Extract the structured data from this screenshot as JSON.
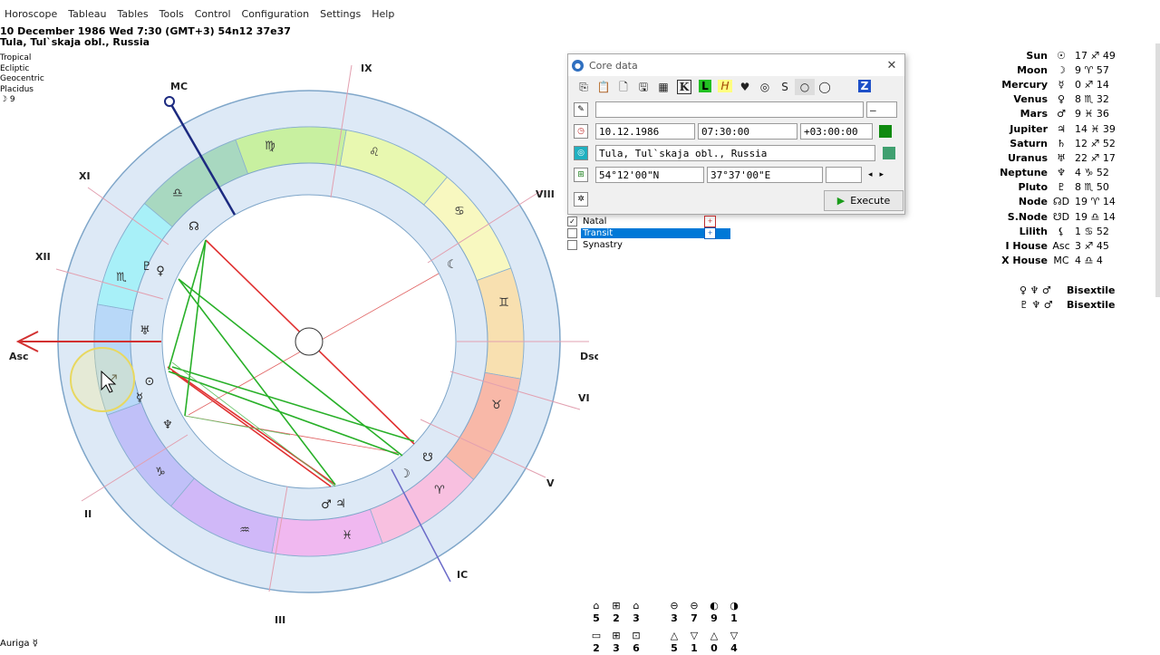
{
  "menu": [
    "Horoscope",
    "Tableau",
    "Tables",
    "Tools",
    "Control",
    "Configuration",
    "Settings",
    "Help"
  ],
  "header": {
    "line1": "10 December 1986  Wed   7:30 (GMT+3) 54n12  37e37",
    "line2": "Tula, Tul`skaja obl., Russia"
  },
  "modes": [
    "Tropical",
    "Ecliptic",
    "Geocentric",
    "Placidus",
    "☽   9"
  ],
  "bottom_label": "Auriga   ☿",
  "chart": {
    "roman": [
      "IX",
      "XI",
      "XII",
      "II",
      "III",
      "IC",
      "V",
      "VI",
      "VIII",
      "MC",
      "Asc",
      "Dsc"
    ],
    "signs": [
      "♍",
      "♌",
      "♋",
      "♊",
      "♉",
      "♈",
      "♓",
      "♒",
      "♑",
      "♐",
      "♏",
      "♎"
    ],
    "points": [
      "☊",
      "♇",
      "♀",
      "♅",
      "⊙",
      "☿",
      "♆",
      "♂",
      "♃",
      "☽",
      "☋",
      "☾"
    ]
  },
  "dialog": {
    "title": "Core data",
    "name_value": "",
    "gender_value": "–",
    "date": "10.12.1986",
    "time": "07:30:00",
    "tz": "+03:00:00",
    "place": "Tula, Tul`skaja obl., Russia",
    "lat": "54°12'00\"N",
    "lon": "37°37'00\"E",
    "extra": "",
    "execute": "Execute"
  },
  "mode_list": [
    {
      "label": "Natal",
      "checked": true
    },
    {
      "label": "Transit",
      "checked": false
    },
    {
      "label": "Synastry",
      "checked": false
    }
  ],
  "planets": [
    {
      "name": "Sun",
      "sym": "☉",
      "val": "17 ♐ 49"
    },
    {
      "name": "Moon",
      "sym": "☽",
      "val": "9 ♈ 57"
    },
    {
      "name": "Mercury",
      "sym": "☿",
      "val": "0 ♐ 14"
    },
    {
      "name": "Venus",
      "sym": "♀",
      "val": "8 ♏ 32"
    },
    {
      "name": "Mars",
      "sym": "♂",
      "val": "9 ♓ 36"
    },
    {
      "name": "Jupiter",
      "sym": "♃",
      "val": "14 ♓ 39"
    },
    {
      "name": "Saturn",
      "sym": "♄",
      "val": "12 ♐ 52"
    },
    {
      "name": "Uranus",
      "sym": "♅",
      "val": "22 ♐ 17"
    },
    {
      "name": "Neptune",
      "sym": "♆",
      "val": "4 ♑ 52"
    },
    {
      "name": "Pluto",
      "sym": "♇",
      "val": "8 ♏ 50"
    },
    {
      "name": "Node",
      "sym": "☊D",
      "val": "19 ♈ 14"
    },
    {
      "name": "S.Node",
      "sym": "☋D",
      "val": "19 ♎ 14"
    },
    {
      "name": "Lilith",
      "sym": "⚸",
      "val": "1 ♋ 52"
    },
    {
      "name": "I House",
      "sym": "Asc",
      "val": "3 ♐ 45"
    },
    {
      "name": "X House",
      "sym": "MC",
      "val": "4 ♎  4"
    }
  ],
  "aspects": [
    {
      "glyphs": "♀ ♆ ♂",
      "name": "Bisextile"
    },
    {
      "glyphs": "♇ ♆ ♂",
      "name": "Bisextile"
    }
  ],
  "patterns_top": [
    {
      "sym": "⌂",
      "num": "5"
    },
    {
      "sym": "⊞",
      "num": "2"
    },
    {
      "sym": "⌂",
      "num": "3"
    },
    {
      "sym": "⊖",
      "num": "3"
    },
    {
      "sym": "⊖",
      "num": "7"
    },
    {
      "sym": "◐",
      "num": "9"
    },
    {
      "sym": "◑",
      "num": "1"
    }
  ],
  "patterns_bottom": [
    {
      "sym": "▭",
      "num": "2"
    },
    {
      "sym": "⊞",
      "num": "3"
    },
    {
      "sym": "⊡",
      "num": "6"
    },
    {
      "sym": "△",
      "num": "5"
    },
    {
      "sym": "▽",
      "num": "1"
    },
    {
      "sym": "△",
      "num": "0"
    },
    {
      "sym": "▽",
      "num": "4"
    }
  ]
}
